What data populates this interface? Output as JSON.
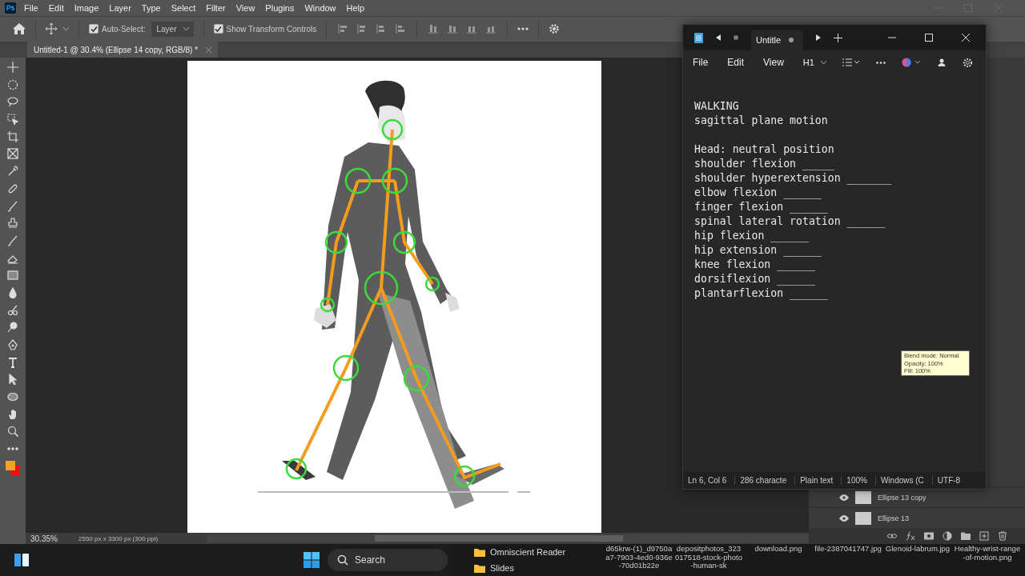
{
  "menu_bar": [
    "File",
    "Edit",
    "Image",
    "Layer",
    "Type",
    "Select",
    "Filter",
    "View",
    "Plugins",
    "Window",
    "Help"
  ],
  "options_bar": {
    "auto_select": {
      "label": "Auto-Select:",
      "checked": true
    },
    "layer_dropdown": "Layer",
    "transform_controls": {
      "label": "Show Transform Controls",
      "checked": true
    }
  },
  "document_tab": {
    "title": "Untitled-1 @ 30.4% (Ellipse 14 copy, RGB/8) *"
  },
  "status": {
    "zoom": "30.35%",
    "size": "2550 px x 3300 px (300 ppi)"
  },
  "layers": [
    {
      "name": "Ellipse 13 copy",
      "visible": true
    },
    {
      "name": "Ellipse 13",
      "visible": true
    }
  ],
  "tooltip": [
    "Blend mode: Normal",
    "Opacity: 100%",
    "Fill: 100%"
  ],
  "notepad": {
    "tab_title": "Untitle",
    "menu": [
      "File",
      "Edit",
      "View"
    ],
    "heading_button": "H1",
    "sections": [
      [
        "WALKING",
        "sagittal plane motion"
      ],
      [
        "Head: neutral position",
        "shoulder flexion _____",
        "shoulder hyperextension _______",
        "elbow flexion ______",
        "finger flexion ______",
        "spinal lateral rotation ______",
        "hip flexion ______",
        "hip extension ______",
        "knee flexion ______",
        "dorsiflexion ______",
        "plantarflexion ______"
      ]
    ],
    "status_bar": [
      "Ln 6, Col 6",
      "286 characte",
      "Plain text",
      "100%",
      "Windows (C",
      "UTF-8"
    ]
  },
  "taskbar": {
    "search_placeholder": "Search",
    "folders": [
      "Omniscient Reader",
      "Slides"
    ],
    "files": [
      "d65krw-(1)_d9750aa7-7903-4ed0-936e-70d01b22e",
      "depositphotos_323017518-stock-photo-human-sk",
      "download.png",
      "file-2387041747.jpg",
      "Glenoid-labrum.jpg",
      "Healthy-wrist-range-of-motion.png"
    ]
  }
}
